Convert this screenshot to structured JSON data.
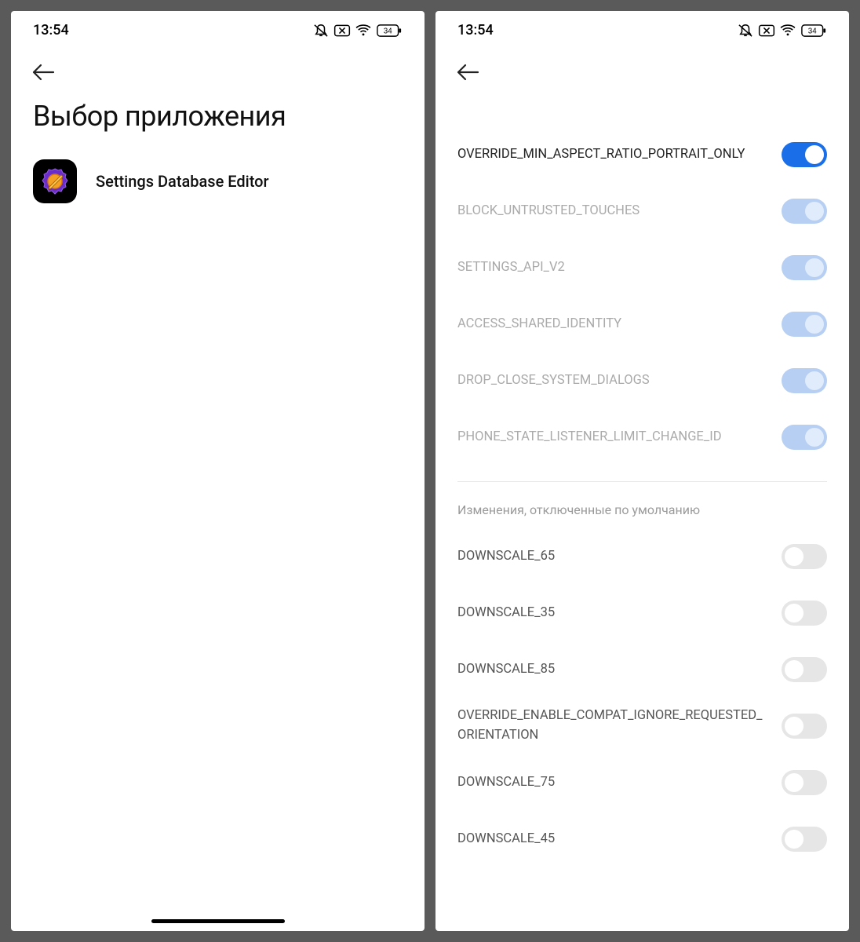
{
  "status": {
    "time": "13:54",
    "battery": "34"
  },
  "left": {
    "title": "Выбор приложения",
    "app": {
      "name": "Settings Database Editor"
    }
  },
  "right": {
    "section1": [
      {
        "label": "OVERRIDE_MIN_ASPECT_RATIO_PORTRAIT_ONLY",
        "state": "on-active"
      },
      {
        "label": "BLOCK_UNTRUSTED_TOUCHES",
        "state": "on-disabled"
      },
      {
        "label": "SETTINGS_API_V2",
        "state": "on-disabled"
      },
      {
        "label": "ACCESS_SHARED_IDENTITY",
        "state": "on-disabled"
      },
      {
        "label": "DROP_CLOSE_SYSTEM_DIALOGS",
        "state": "on-disabled"
      },
      {
        "label": "PHONE_STATE_LISTENER_LIMIT_CHANGE_ID",
        "state": "on-disabled"
      }
    ],
    "section2_header": "Изменения, отключенные по умолчанию",
    "section2": [
      {
        "label": "DOWNSCALE_65",
        "state": "off"
      },
      {
        "label": "DOWNSCALE_35",
        "state": "off"
      },
      {
        "label": "DOWNSCALE_85",
        "state": "off"
      },
      {
        "label": "OVERRIDE_ENABLE_COMPAT_IGNORE_REQUESTED_ORIENTATION",
        "state": "off"
      },
      {
        "label": "DOWNSCALE_75",
        "state": "off"
      },
      {
        "label": "DOWNSCALE_45",
        "state": "off"
      }
    ]
  }
}
